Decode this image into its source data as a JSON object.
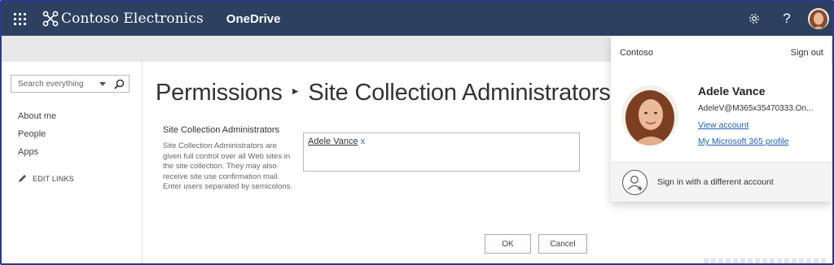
{
  "suite_bar": {
    "brand_name": "Contoso Electronics",
    "app_name": "OneDrive",
    "colors": {
      "background": "#2d4060",
      "text": "#ffffff"
    },
    "icons": [
      "app-launcher-icon",
      "settings-gear-icon",
      "help-icon"
    ]
  },
  "left_nav": {
    "search_placeholder": "Search everything",
    "items": [
      {
        "label": "About me"
      },
      {
        "label": "People"
      },
      {
        "label": "Apps"
      }
    ],
    "edit_links": "EDIT LINKS"
  },
  "main": {
    "breadcrumb_parent": "Permissions",
    "breadcrumb_current": "Site Collection Administrators",
    "section_title": "Site Collection Administrators",
    "section_description": "Site Collection Administrators are given full control over all Web sites in the site collection. They may also receive site use confirmation mail. Enter users separated by semicolons.",
    "people_picker": {
      "user_name": "Adele Vance",
      "remove_label": "x"
    },
    "ok_label": "OK",
    "cancel_label": "Cancel"
  },
  "account_flyout": {
    "org": "Contoso",
    "sign_out": "Sign out",
    "user_name": "Adele Vance",
    "email": "AdeleV@M365x35470333.On...",
    "view_account": "View account",
    "profile_link": "My Microsoft 365 profile",
    "switch_account": "Sign in with a different account",
    "link_color": "#1f5fb0"
  }
}
